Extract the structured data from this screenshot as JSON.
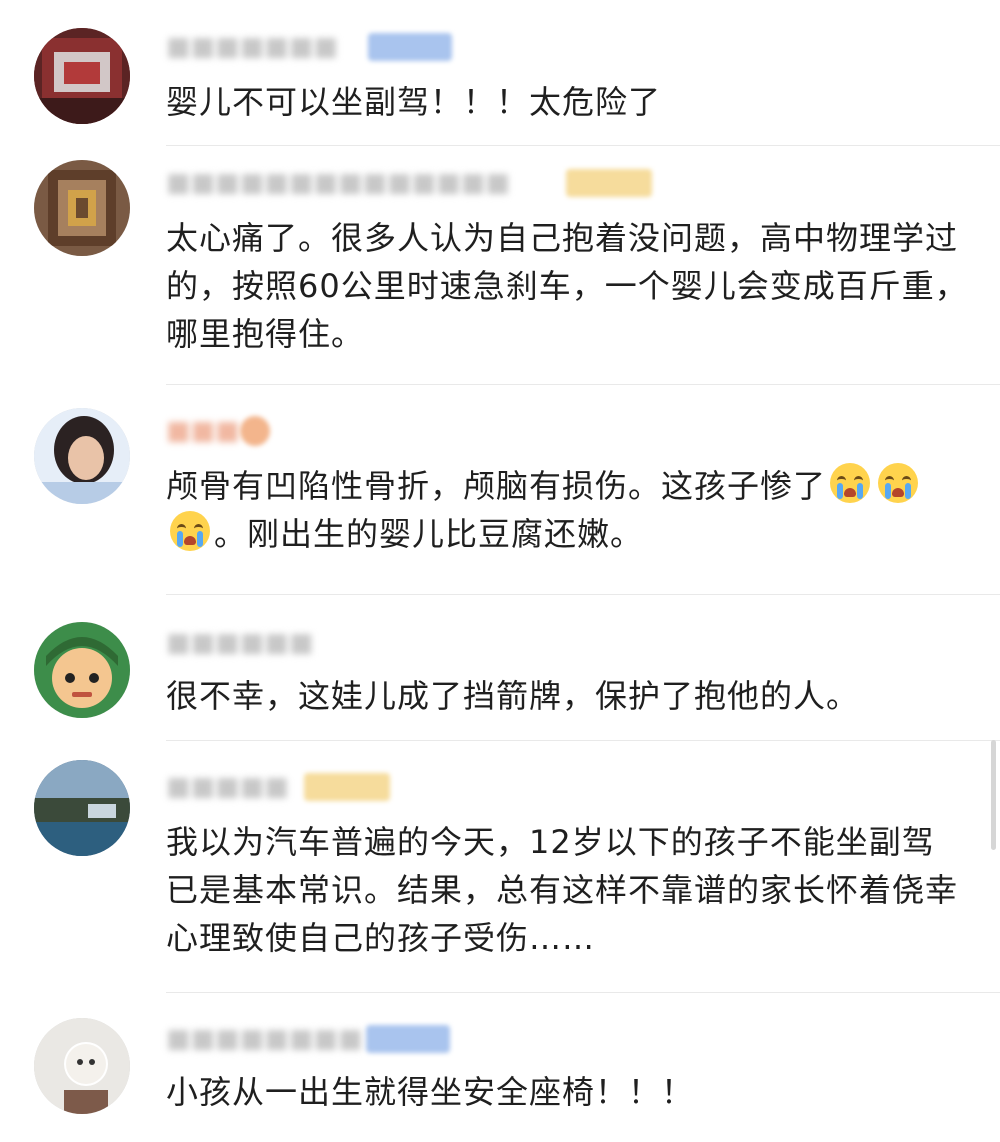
{
  "colors": {
    "text": "#1f1f1f",
    "username_blurred": "#c8c8c8",
    "badge_blue": "#a9c4ee",
    "badge_gold": "#f6dc9c",
    "emoji_yellow": "#ffd34d",
    "divider": "#e9e9e9"
  },
  "comments": [
    {
      "username": "",
      "badge_color": "blue",
      "avatar_icon": "user-avatar-icon",
      "text": "婴儿不可以坐副驾！！！太危险了"
    },
    {
      "username": "",
      "badge_color": "gold",
      "avatar_icon": "user-avatar-icon",
      "text": "太心痛了。很多人认为自己抱着没问题，高中物理学过的，按照60公里时速急刹车，一个婴儿会变成百斤重，哪里抱得住。"
    },
    {
      "username": "",
      "badge_color": "orange",
      "avatar_icon": "user-avatar-icon",
      "text_part1": "颅骨有凹陷性骨折，颅脑有损伤。这孩子惨了",
      "emoji_icon": "crying-face-emoji-icon",
      "text_part2": "。刚出生的婴儿比豆腐还嫩。"
    },
    {
      "username": "",
      "badge_color": "none",
      "avatar_icon": "user-avatar-icon",
      "text": "很不幸，这娃儿成了挡箭牌，保护了抱他的人。"
    },
    {
      "username": "",
      "badge_color": "gold",
      "avatar_icon": "user-avatar-icon",
      "text": "我以为汽车普遍的今天，12岁以下的孩子不能坐副驾已是基本常识。结果，总有这样不靠谱的家长怀着侥幸心理致使自己的孩子受伤……"
    },
    {
      "username": "",
      "badge_color": "blue",
      "avatar_icon": "user-avatar-icon",
      "text": "小孩从一出生就得坐安全座椅！！！"
    }
  ]
}
